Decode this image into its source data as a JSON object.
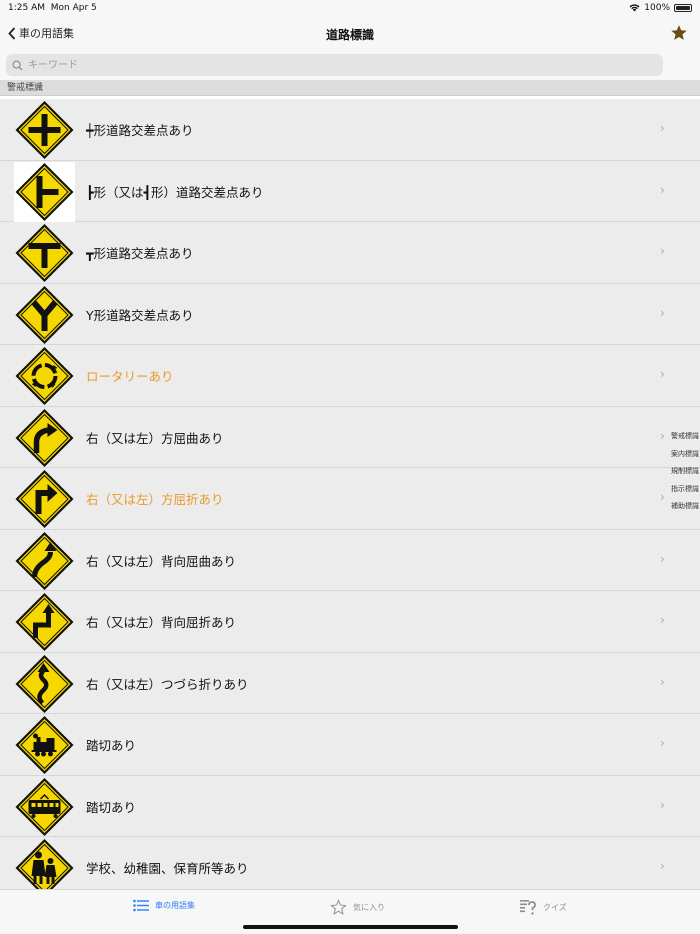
{
  "status": {
    "time": "1:25 AM",
    "date": "Mon Apr 5",
    "battery": "100%"
  },
  "nav": {
    "back_label": "車の用語集",
    "title": "道路標識"
  },
  "search": {
    "placeholder": "キーワード"
  },
  "section": {
    "title": "警戒標識"
  },
  "rows": [
    {
      "label": "┿形道路交差点あり",
      "icon": "crossroads-sign-icon",
      "highlight": false
    },
    {
      "label": "┣形（又は┫形）道路交差点あり",
      "icon": "t-junction-side-sign-icon",
      "highlight": false
    },
    {
      "label": "┳形道路交差点あり",
      "icon": "t-junction-sign-icon",
      "highlight": false
    },
    {
      "label": "Y形道路交差点あり",
      "icon": "y-junction-sign-icon",
      "highlight": false
    },
    {
      "label": "ロータリーあり",
      "icon": "roundabout-sign-icon",
      "highlight": true
    },
    {
      "label": "右（又は左）方屈曲あり",
      "icon": "curve-right-sign-icon",
      "highlight": false
    },
    {
      "label": "右（又は左）方屈折あり",
      "icon": "turn-right-sign-icon",
      "highlight": true
    },
    {
      "label": "右（又は左）背向屈曲あり",
      "icon": "reverse-curve-sign-icon",
      "highlight": false
    },
    {
      "label": "右（又は左）背向屈折あり",
      "icon": "reverse-turn-sign-icon",
      "highlight": false
    },
    {
      "label": "右（又は左）つづら折りあり",
      "icon": "winding-road-sign-icon",
      "highlight": false
    },
    {
      "label": "踏切あり",
      "icon": "railroad-crossing-steam-sign-icon",
      "highlight": false
    },
    {
      "label": "踏切あり",
      "icon": "railroad-crossing-tram-sign-icon",
      "highlight": false
    },
    {
      "label": "学校、幼稚園、保育所等あり",
      "icon": "school-zone-sign-icon",
      "highlight": false
    }
  ],
  "index": [
    "警戒標識",
    "案内標識",
    "規制標識",
    "指示標識",
    "補助標識"
  ],
  "tabs": [
    {
      "label": "車の用語集",
      "icon": "list-icon",
      "active": true
    },
    {
      "label": "気に入り",
      "icon": "star-outline-icon",
      "active": false
    },
    {
      "label": "クイズ",
      "icon": "quiz-icon",
      "active": false
    }
  ],
  "colors": {
    "sign_yellow": "#f5d800",
    "highlight": "#e99a2a",
    "accent": "#2f7cf6",
    "star": "#6b4b18"
  }
}
